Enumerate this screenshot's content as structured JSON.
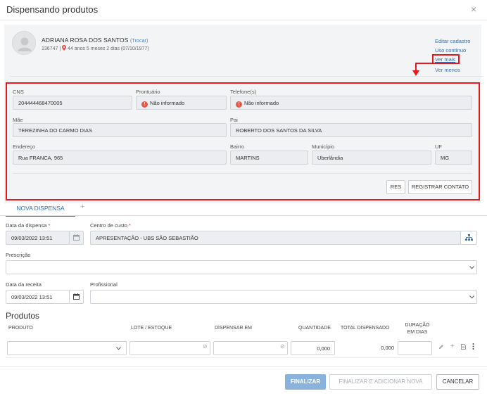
{
  "window": {
    "title": "Dispensando produtos",
    "close_glyph": "×"
  },
  "patient": {
    "name": "ADRIANA ROSA DOS SANTOS",
    "trocar": "(Trocar)",
    "id": "136747",
    "separator": "|",
    "age": "44 anos 5 meses 2 dias (07/10/1977)",
    "links": {
      "edit": "Editar cadastro",
      "continuous": "Uso contínuo",
      "more": "Ver mais",
      "less": "Ver menos"
    }
  },
  "details": {
    "cns": {
      "label": "CNS",
      "value": "204444468470005"
    },
    "prontuario": {
      "label": "Prontuário",
      "value": "Não informado"
    },
    "telefone": {
      "label": "Telefone(s)",
      "value": "Não informado"
    },
    "mae": {
      "label": "Mãe",
      "value": "TEREZINHA DO CARMO DIAS"
    },
    "pai": {
      "label": "Pai",
      "value": "ROBERTO DOS SANTOS DA SILVA"
    },
    "endereco": {
      "label": "Endereço",
      "value": "Rua FRANCA, 965"
    },
    "bairro": {
      "label": "Bairro",
      "value": "MARTINS"
    },
    "municipio": {
      "label": "Município",
      "value": "Uberlândia"
    },
    "uf": {
      "label": "UF",
      "value": "MG"
    },
    "warn_glyph": "!",
    "buttons": {
      "res": "RES",
      "registrar": "REGISTRAR CONTATO"
    }
  },
  "tabs": {
    "active": "NOVA DISPENSA",
    "add": "+"
  },
  "form": {
    "data_dispensa": {
      "label": "Data da dispensa",
      "value": "09/03/2022 13:51"
    },
    "centro_custo": {
      "label": "Centro de custo",
      "value": "APRESENTAÇÃO - UBS SÃO SEBASTIÃO"
    },
    "prescricao": {
      "label": "Prescrição",
      "value": ""
    },
    "data_receita": {
      "label": "Data da receita",
      "value": "09/03/2022 13:51"
    },
    "profissional": {
      "label": "Profissional",
      "value": ""
    },
    "required_mark": "*"
  },
  "products": {
    "title": "Produtos",
    "headers": {
      "produto": "PRODUTO",
      "lote": "LOTE / ESTOQUE",
      "dispensar": "DISPENSAR EM",
      "quantidade": "QUANTIDADE",
      "total": "TOTAL DISPENSADO",
      "duracao_1": "DURAÇÃO",
      "duracao_2": "EM DIAS"
    },
    "row": {
      "quantidade": "0,000",
      "total": "0,000"
    }
  },
  "icons": {
    "calendar": "calendar-icon",
    "hierarchy": "hierarchy-icon",
    "chevron": "chevron-down-icon",
    "pencil": "pencil-icon",
    "plus": "plus-icon",
    "document": "document-icon",
    "more": "more-vertical-icon",
    "clear": "clear-icon"
  },
  "footer": {
    "finalizar": "FINALIZAR",
    "finalizar_nova": "FINALIZAR E ADICIONAR NOVA",
    "cancelar": "CANCELAR"
  },
  "colors": {
    "primary": "#2e6db4",
    "highlight_red": "#e8181f",
    "warning": "#e05a4c",
    "finalizar_bg": "#89b3dd"
  }
}
